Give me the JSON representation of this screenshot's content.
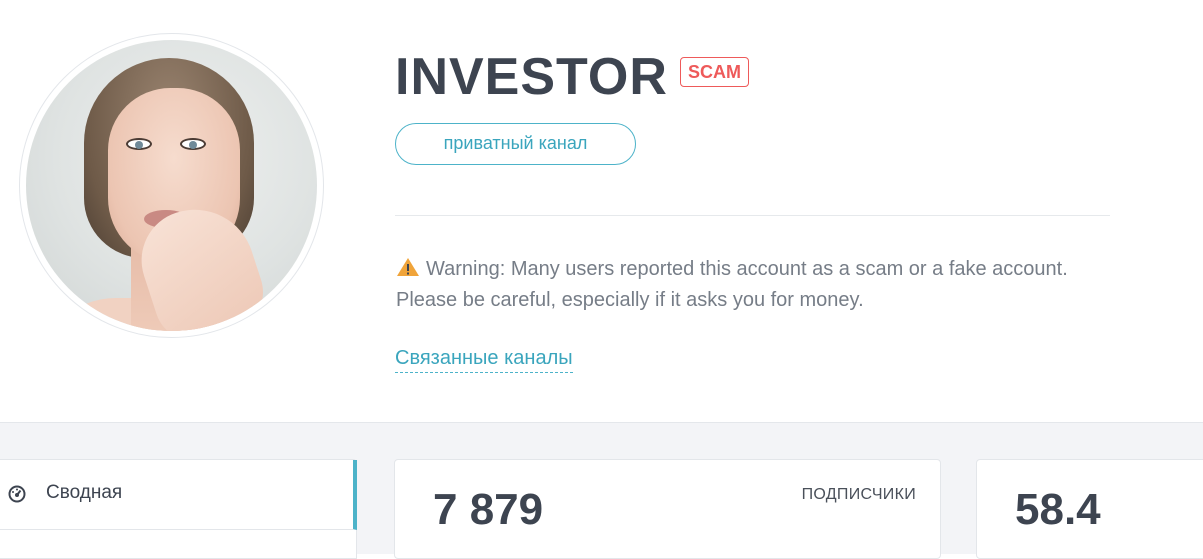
{
  "channel": {
    "title": "INVESTOR",
    "badge": "SCAM",
    "type_label": "приватный канал",
    "warning": "Warning: Many users reported this account as a scam or a fake account. Please be careful, especially if it asks you for money.",
    "related_link": "Связанные каналы"
  },
  "sidebar": {
    "items": [
      {
        "label": "Сводная",
        "icon": "dashboard-icon",
        "active": true
      }
    ]
  },
  "stats": [
    {
      "value": "7 879",
      "label": "ПОДПИСЧИКИ"
    },
    {
      "value": "58.4",
      "label": ""
    }
  ],
  "colors": {
    "accent": "#4db3c9",
    "scam": "#ee5a5a",
    "text": "#3d4450",
    "muted": "#767d87",
    "background": "#f3f4f7"
  }
}
